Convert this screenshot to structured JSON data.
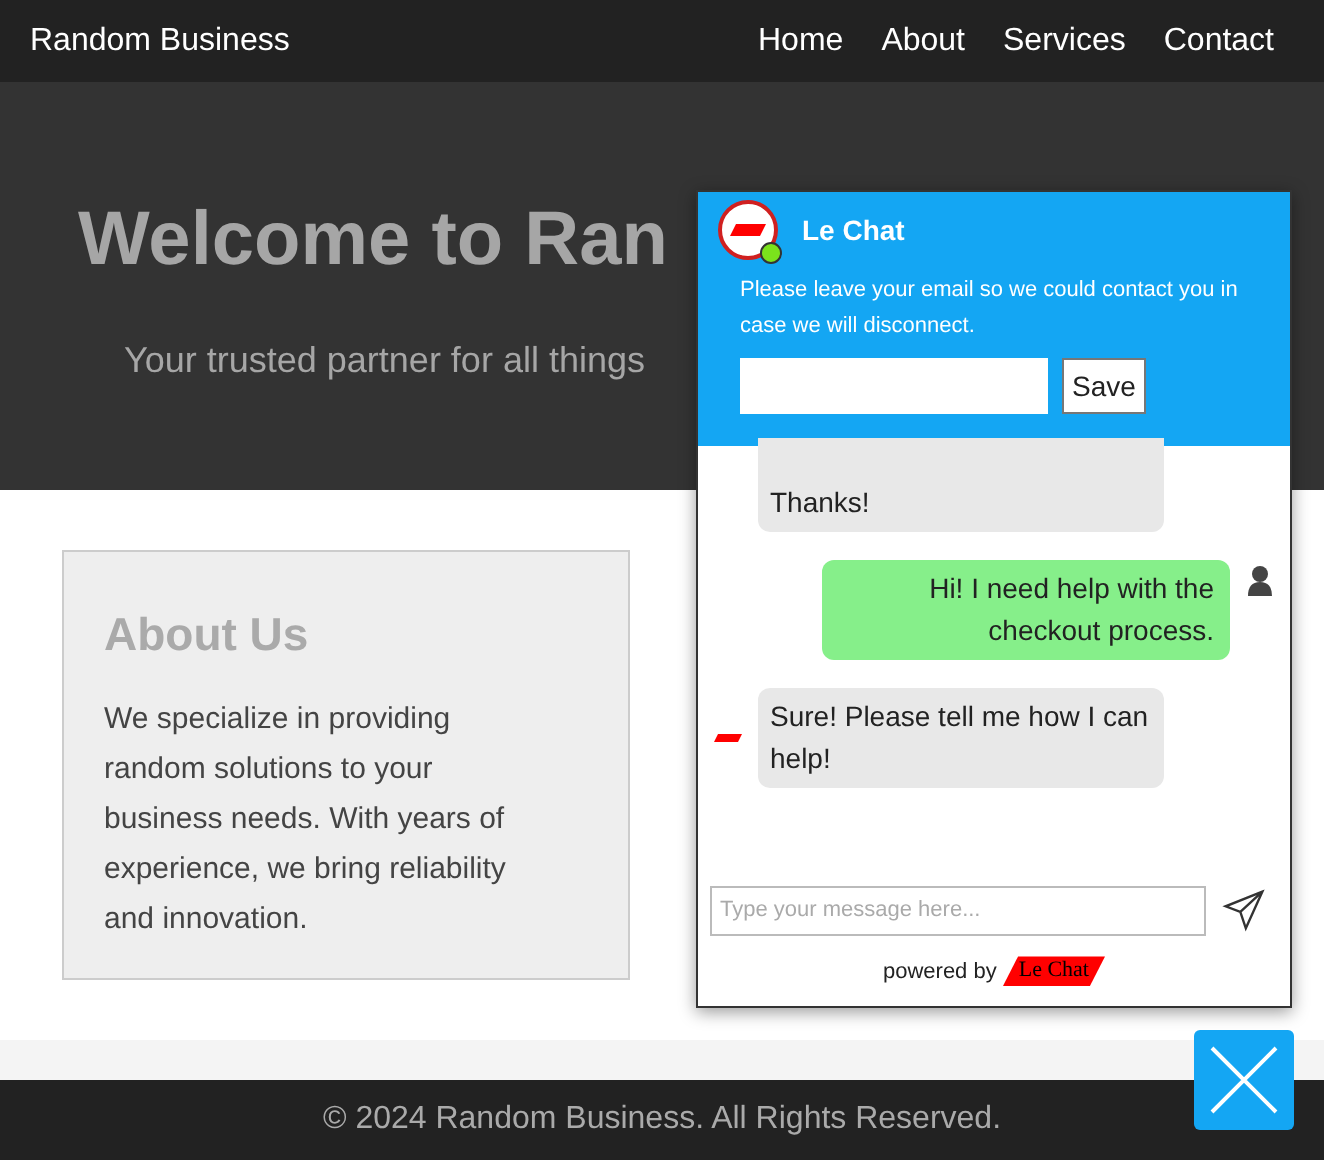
{
  "navbar": {
    "brand": "Random Business",
    "links": [
      "Home",
      "About",
      "Services",
      "Contact"
    ]
  },
  "hero": {
    "title": "Welcome to Ran",
    "subtitle": "Your trusted partner for all things"
  },
  "about": {
    "title": "About Us",
    "text": "We specialize in providing random solutions to your business needs. With years of experience, we bring reliability and innovation."
  },
  "footer": {
    "text": "© 2024 Random Business. All Rights Reserved."
  },
  "chat": {
    "title": "Le Chat",
    "online": true,
    "notice": "Please leave your email so we could contact you in case we will disconnect.",
    "save_button": "Save",
    "messages": [
      {
        "kind": "agent",
        "text": "Thanks!",
        "avatar": false
      },
      {
        "kind": "user",
        "text": "Hi! I need help with the checkout process.",
        "avatar": true
      },
      {
        "kind": "agent",
        "text": "Sure! Please tell me how I can help!",
        "avatar": true
      }
    ],
    "input_placeholder": "Type your message here...",
    "powered_by": "powered by",
    "brand_logo": "Le Chat"
  }
}
